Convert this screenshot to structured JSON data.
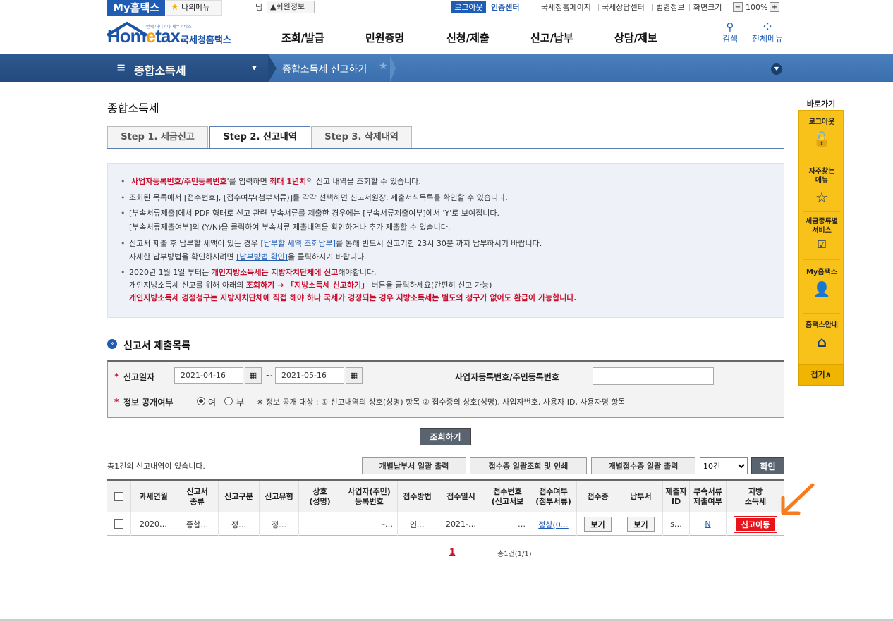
{
  "util": {
    "myhome": "My홈택스",
    "mymenu": "나의메뉴",
    "name_suffix": "님",
    "member_info": "회원정보",
    "logout": "로그아웃",
    "cert_center": "인증센터",
    "links": [
      "국세청홈페이지",
      "국세상담센터",
      "법령정보",
      "화면크기"
    ],
    "zoom_minus": "−",
    "zoom": "100%",
    "zoom_plus": "+"
  },
  "header": {
    "logo_small": "언제 어디서나 세무서비스",
    "logo_home": "Hom",
    "logo_e": "e",
    "logo_tax": "tax.",
    "logo_kr": "국세청홈택스",
    "gnb": [
      "조회/발급",
      "민원증명",
      "신청/제출",
      "신고/납부",
      "상담/제보"
    ],
    "search": "검색",
    "allmenu": "전체메뉴"
  },
  "nav": {
    "menu_icon": "≡",
    "title": "종합소득세",
    "current": "종합소득세 신고하기"
  },
  "page": {
    "title": "종합소득세",
    "tabs": [
      "Step 1. 세금신고",
      "Step 2. 신고내역",
      "Step 3. 삭제내역"
    ]
  },
  "info": {
    "l1_a": "'",
    "l1_b": "사업자등록번호/주민등록번호",
    "l1_c": "'를 입력하면 ",
    "l1_d": "최대 1년치",
    "l1_e": "의 신고 내역을 조회할 수 있습니다.",
    "l2": "조회된 목록에서 [접수번호], [접수여부(첨부서류)]를 각각 선택하면 신고서원장, 제출서식목록를 확인할 수 있습니다.",
    "l3a": "[부속서류제출]에서 PDF 형태로 신고 관련 부속서류를 제출한 경우에는 [부속서류제출여부]에서 'Y'로 보여집니다.",
    "l3b": "[부속서류제출여부]의 (Y/N)을 클릭하여 부속서류 제출내역을 확인하거나 추가 제출할 수 있습니다.",
    "l4a_1": "신고서 제출 후 납부할 세액이 있는 경우 ",
    "l4a_link": "[납부할 세액 조회납부]",
    "l4a_2": "를 통해 반드시 신고기한 23시 30분 까지 납부하시기 바랍니다.",
    "l4b_1": "자세한 납부방법을 확인하시려면 ",
    "l4b_link": "[납부방법 확인]",
    "l4b_2": "을 클릭하시기 바랍니다.",
    "l5a_1": "2020년 1월 1일 부터는 ",
    "l5a_red": "개인지방소득세는 지방자치단체에 신고",
    "l5a_2": "해야합니다.",
    "l5b_1": "개인지방소득세 신고를 위해 아래의 ",
    "l5b_red": "조회하기 → 「지방소득세 신고하기」",
    "l5b_2": " 버튼을 클릭하세요(간편히 신고 가능)",
    "l6": "개인지방소득세 경정청구는 지방자치단체에 직접 해야 하나 국세가 경정되는 경우 지방소득세는 별도의 청구가 없어도 환급이 가능합니다."
  },
  "section": {
    "icon": "»",
    "title": "신고서 제출목록"
  },
  "form": {
    "date_label": "신고일자",
    "date_from": "2021-04-16",
    "date_to": "2021-05-16",
    "tilde": "~",
    "cal_icon": "▦",
    "biz_label": "사업자등록번호/주민등록번호",
    "biz_value": "",
    "public_label": "정보 공개여부",
    "yes": "여",
    "no": "부",
    "public_note": "※ 정보 공개 대상 : ① 신고내역의 상호(성명) 항목 ② 접수증의 상호(성명), 사업자번호, 사용자 ID, 사용자명 항목"
  },
  "buttons": {
    "query": "조회하기",
    "bulk_payment": "개별납부서 일괄 출력",
    "bulk_receipt": "접수증 일괄조회 및 인쇄",
    "bulk_indiv_receipt": "개별접수증 일괄 출력",
    "page_size": "10건",
    "confirm": "확인"
  },
  "count_text": "총1건의 신고내역이 있습니다.",
  "table": {
    "headers": [
      "",
      "과세연월",
      "신고서\n종류",
      "신고구분",
      "신고유형",
      "상호\n(성명)",
      "사업자(주민)\n등록번호",
      "접수방법",
      "접수일시",
      "접수번호\n(신고서보",
      "접수여부\n(첨부서류)",
      "접수증",
      "납부서",
      "제출자\nID",
      "부속서류\n제출여부",
      "지방\n소득세"
    ],
    "row": {
      "period": "2020…",
      "type": "종합…",
      "div": "정…",
      "kind": "정…",
      "name": "",
      "regno": "–…",
      "method": "인…",
      "datetime": "2021-…",
      "recno": "…",
      "status": "정상(0…",
      "receipt_btn": "보기",
      "payment_btn": "보기",
      "submitter": "s…",
      "attach": "N",
      "local_btn": "신고이동"
    }
  },
  "pagination": {
    "current": "1",
    "total": "총1건(1/1)"
  },
  "quick": {
    "title": "바로가기",
    "items": [
      "로그아웃",
      "자주찾는\n메뉴",
      "세금종류별\n서비스",
      "My홈택스",
      "홈택스안내"
    ],
    "close": "접기∧"
  }
}
